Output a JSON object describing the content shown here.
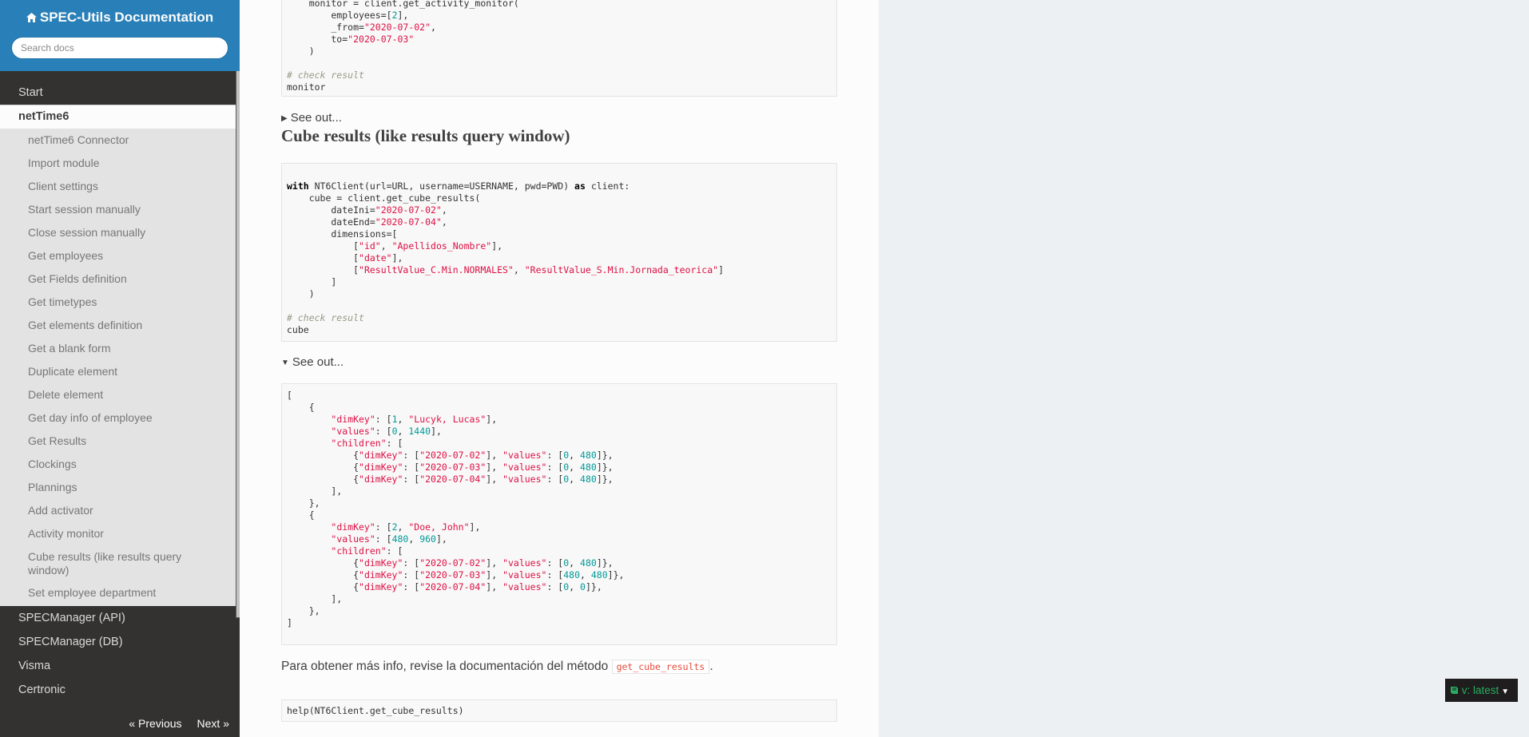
{
  "sidebar": {
    "title": "SPEC-Utils Documentation",
    "search_placeholder": "Search docs",
    "top_items": [
      "Start"
    ],
    "current": "netTime6",
    "sub_items": [
      "netTime6 Connector",
      "Import module",
      "Client settings",
      "Start session manually",
      "Close session manually",
      "Get employees",
      "Get Fields definition",
      "Get timetypes",
      "Get elements definition",
      "Get a blank form",
      "Duplicate element",
      "Delete element",
      "Get day info of employee",
      "Get Results",
      "Clockings",
      "Plannings",
      "Add activator",
      "Activity monitor",
      "Cube results (like results query window)",
      "Set employee department"
    ],
    "bottom_items": [
      "SPECManager (API)",
      "SPECManager (DB)",
      "Visma",
      "Certronic"
    ],
    "prev": "« Previous",
    "next": "Next »"
  },
  "content": {
    "see_out_1": "See out...",
    "heading": "Cube results (like results query window)",
    "see_out_2": "See out...",
    "para_text": "Para obtener más info, revise la documentación del método",
    "para_code": "get_cube_results",
    "para_end": "."
  },
  "version": {
    "label": "v: latest"
  },
  "colors": {
    "sidebar_bg": "#343131",
    "header_blue": "#2980b9",
    "subnav_bg": "#e3e3e3",
    "string_red": "#dd1144",
    "number_teal": "#009999"
  }
}
